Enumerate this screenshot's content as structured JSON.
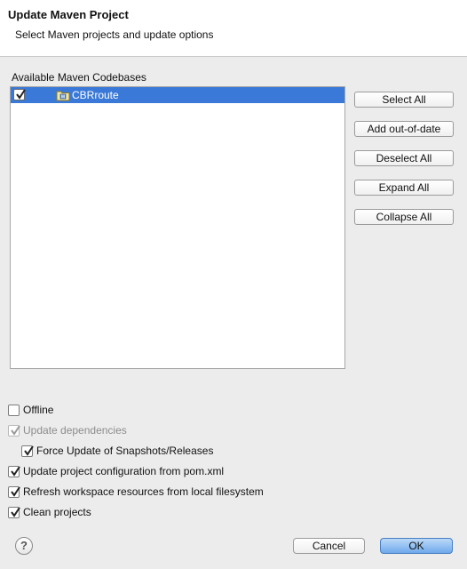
{
  "header": {
    "title": "Update Maven Project",
    "subtitle": "Select Maven projects and update options"
  },
  "codebases": {
    "label": "Available Maven Codebases",
    "items": [
      {
        "name": "CBRroute",
        "checked": true,
        "selected": true,
        "icon": "maven-project-icon"
      }
    ]
  },
  "side_buttons": {
    "select_all": "Select All",
    "add_out_of_date": "Add out-of-date",
    "deselect_all": "Deselect All",
    "expand_all": "Expand All",
    "collapse_all": "Collapse All"
  },
  "options": {
    "offline": {
      "label": "Offline",
      "checked": false,
      "enabled": true
    },
    "update_dependencies": {
      "label": "Update dependencies",
      "checked": true,
      "enabled": false
    },
    "force_update": {
      "label": "Force Update of Snapshots/Releases",
      "checked": true,
      "enabled": true
    },
    "update_config": {
      "label": "Update project configuration from pom.xml",
      "checked": true,
      "enabled": true
    },
    "refresh_workspace": {
      "label": "Refresh workspace resources from local filesystem",
      "checked": true,
      "enabled": true
    },
    "clean_projects": {
      "label": "Clean projects",
      "checked": true,
      "enabled": true
    }
  },
  "footer": {
    "help_glyph": "?",
    "cancel_label": "Cancel",
    "ok_label": "OK"
  },
  "colors": {
    "selection": "#3a79d7",
    "ok_button": "#6fa9ec"
  }
}
